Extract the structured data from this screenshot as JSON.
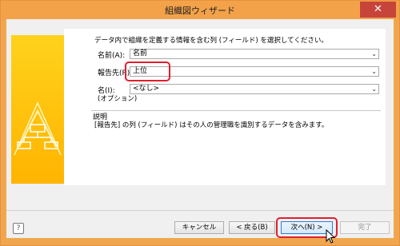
{
  "window": {
    "title": "組織図ウィザード",
    "close_label": "✕"
  },
  "instruction": "データ内で組織を定義する情報を含む列 (フィールド) を選択してください。",
  "fields": {
    "name": {
      "label": "名前(A):",
      "value": "名前"
    },
    "reports_to": {
      "label": "報告先(R)",
      "value": "上位"
    },
    "title": {
      "label": "名(I):",
      "sublabel": "(オプション)",
      "value": "<なし>"
    }
  },
  "description": {
    "title": "説明",
    "text": "[報告先] の列 (フィールド) はその人の管理職を識別するデータを含みます。"
  },
  "buttons": {
    "help": "?",
    "cancel": "キャンセル",
    "back": "< 戻る(B)",
    "next": "次へ(N) >",
    "finish": "完了"
  },
  "colors": {
    "accent": "#f3a24a",
    "highlight": "#e11f2d"
  }
}
